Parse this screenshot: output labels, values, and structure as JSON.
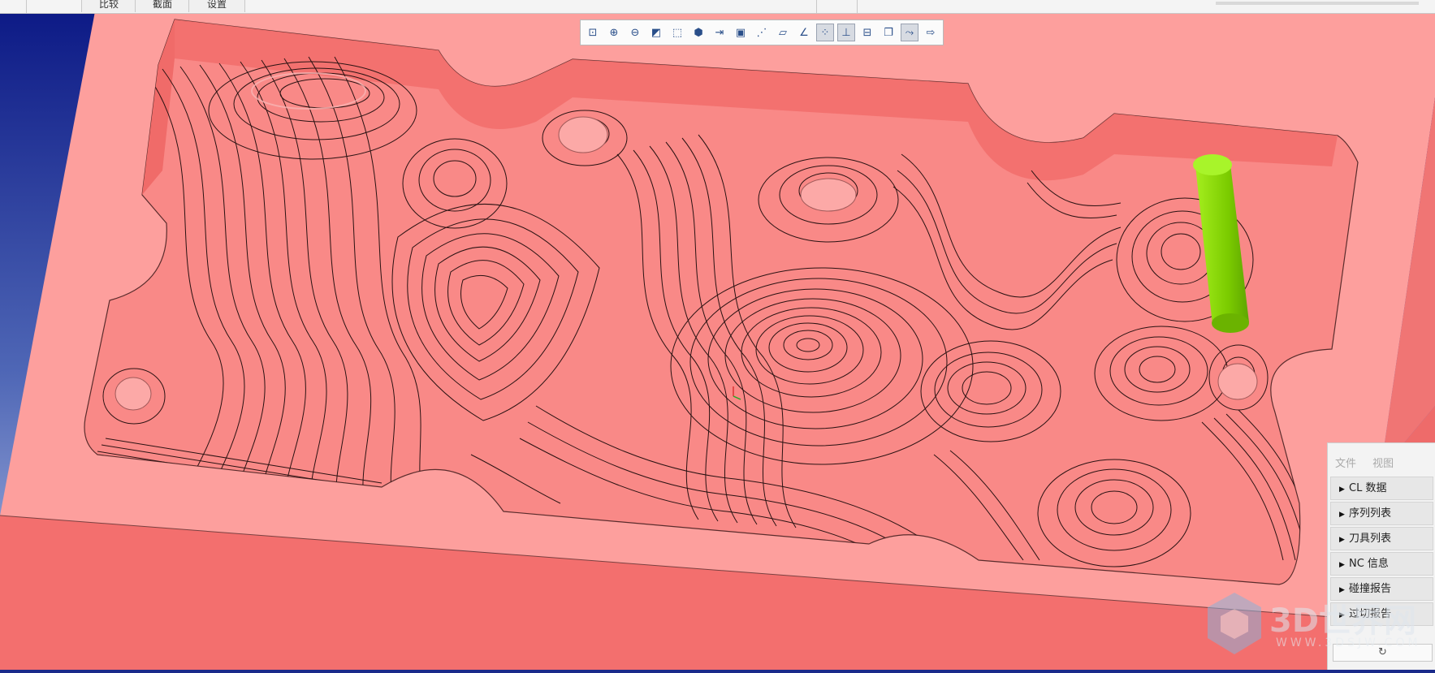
{
  "tabs": [
    {
      "label": "比较"
    },
    {
      "label": "截面"
    },
    {
      "label": "设置"
    }
  ],
  "toolbar": {
    "buttons": [
      {
        "icon": "zoom-fit-icon",
        "glyph": "⊡",
        "active": false
      },
      {
        "icon": "zoom-in-icon",
        "glyph": "⊕",
        "active": false
      },
      {
        "icon": "zoom-out-icon",
        "glyph": "⊖",
        "active": false
      },
      {
        "icon": "front-view-icon",
        "glyph": "◩",
        "active": false
      },
      {
        "icon": "iso-view-icon",
        "glyph": "⬚",
        "active": false
      },
      {
        "icon": "shaded-cube-icon",
        "glyph": "⬢",
        "active": false
      },
      {
        "icon": "export-icon",
        "glyph": "⇥",
        "active": false
      },
      {
        "icon": "camera-icon",
        "glyph": "▣",
        "active": false
      },
      {
        "icon": "toolpath-icon",
        "glyph": "⋰",
        "active": false
      },
      {
        "icon": "plane-icon",
        "glyph": "▱",
        "active": false
      },
      {
        "icon": "measure-icon",
        "glyph": "∠",
        "active": false
      },
      {
        "icon": "points-icon",
        "glyph": "⁘",
        "active": true
      },
      {
        "icon": "axis-icon",
        "glyph": "⊥",
        "active": true
      },
      {
        "icon": "section-icon",
        "glyph": "⊟",
        "active": false
      },
      {
        "icon": "book-icon",
        "glyph": "❐",
        "active": false
      },
      {
        "icon": "path-link-icon",
        "glyph": "⤳",
        "active": true
      },
      {
        "icon": "output-icon",
        "glyph": "⇨",
        "active": false
      }
    ]
  },
  "panel": {
    "menu": [
      {
        "label": "文件"
      },
      {
        "label": "视图"
      }
    ],
    "items": [
      {
        "label": "CL 数据"
      },
      {
        "label": "序列列表"
      },
      {
        "label": "刀具列表"
      },
      {
        "label": "NC 信息"
      },
      {
        "label": "碰撞报告"
      },
      {
        "label": "过切报告"
      }
    ],
    "refresh_glyph": "↻"
  },
  "watermark": {
    "text": "3D世界网",
    "url": "WWW.3DSJW.COM"
  },
  "colors": {
    "background": "#1a2a8a",
    "part": "#fb9e9c",
    "tool": "#84d400"
  }
}
